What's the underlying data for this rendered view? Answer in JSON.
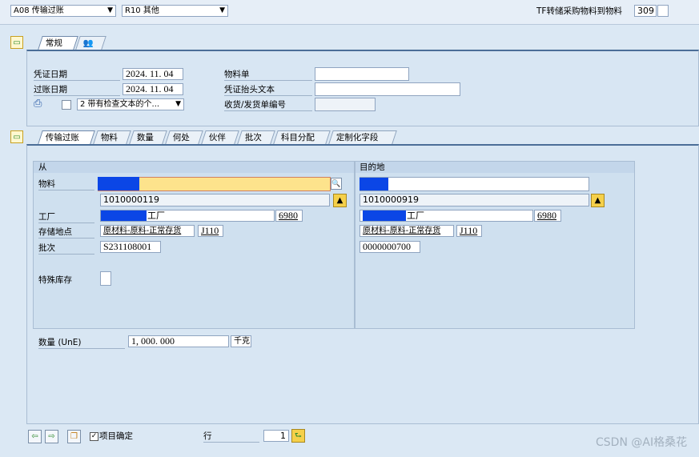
{
  "top": {
    "action_select": "A08 传输过账",
    "movement_select": "R10 其他",
    "right_label": "TF转储采购物料到物料",
    "mvt_type": "309"
  },
  "header_tabs": {
    "tab1": "常规",
    "tab2": "👥"
  },
  "header": {
    "doc_date_label": "凭证日期",
    "doc_date": "2024. 11. 04",
    "post_date_label": "过账日期",
    "post_date": "2024. 11. 04",
    "print_option": "2 带有检查文本的个...",
    "material_slip_label": "物料单",
    "header_text_label": "凭证抬头文本",
    "goods_receipt_label": "收货/发货单编号"
  },
  "item_tabs": [
    "传输过账",
    "物料",
    "数量",
    "何处",
    "伙伴",
    "批次",
    "科目分配",
    "定制化字段"
  ],
  "from": {
    "title": "从",
    "material_label": "物料",
    "material_no": "1010000119",
    "plant_label": "工厂",
    "plant_name": "工厂",
    "plant_code": "6980",
    "sloc_label": "存储地点",
    "sloc_name": "原材料-原料-正常存货",
    "sloc_code": "J110",
    "batch_label": "批次",
    "batch": "S231108001",
    "special_stock_label": "特殊库存"
  },
  "to": {
    "title": "目的地",
    "material_no": "1010000919",
    "plant_name": "工厂",
    "plant_code": "6980",
    "sloc_name": "原材料-原料-正常存货",
    "sloc_code": "J110",
    "batch": "0000000700"
  },
  "quantity": {
    "label": "数量 (UnE)",
    "value": "1, 000. 000",
    "unit": "千克"
  },
  "bottom": {
    "item_ok_label": "项目确定",
    "line_label": "行",
    "line_value": "1"
  },
  "watermark": "CSDN @AI格桑花",
  "colors": {
    "redact": "#0b46e6",
    "highlight_field": "#fde38c",
    "panel": "#cfe0ef"
  }
}
